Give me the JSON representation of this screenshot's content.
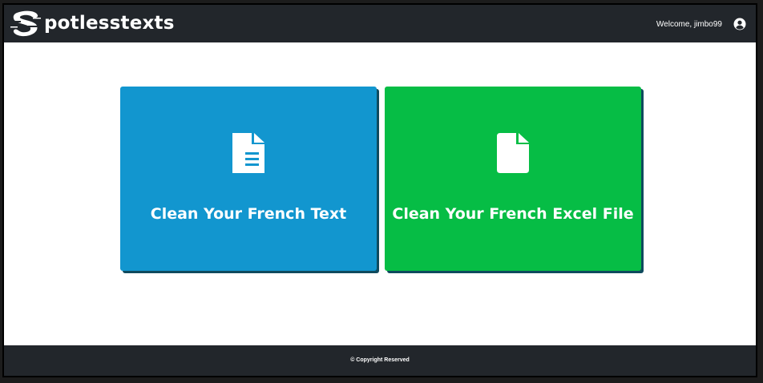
{
  "header": {
    "logo_text": "potlesstexts",
    "welcome_text": "Welcome, jimbo99",
    "user_icon": "user-circle-icon"
  },
  "main": {
    "cards": [
      {
        "label": "Clean Your French Text",
        "icon": "text-document-icon",
        "color": "#1296cf"
      },
      {
        "label": "Clean Your French Excel File",
        "icon": "file-icon",
        "color": "#06bd45"
      }
    ]
  },
  "footer": {
    "copyright": "© Copyright Reserved"
  },
  "colors": {
    "header_bg": "#22262b",
    "footer_bg": "#22262b",
    "page_bg": "#ffffff"
  }
}
